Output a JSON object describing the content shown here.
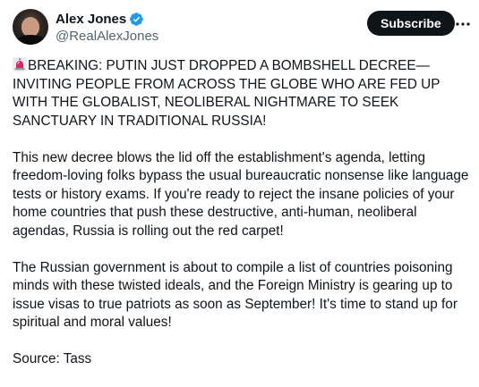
{
  "author": {
    "display_name": "Alex Jones",
    "handle": "@RealAlexJones",
    "verified": true
  },
  "actions": {
    "subscribe_label": "Subscribe",
    "more_icon": "more-horizontal-icon"
  },
  "post": {
    "headline_emoji": "siren-icon",
    "headline": "BREAKING: PUTIN JUST DROPPED A BOMBSHELL DECREE—INVITING PEOPLE FROM ACROSS THE GLOBE WHO ARE FED UP WITH THE GLOBALIST, NEOLIBERAL NIGHTMARE TO SEEK SANCTUARY IN TRADITIONAL RUSSIA!",
    "paragraph_2": "This new decree blows the lid off the establishment's agenda, letting freedom-loving folks bypass the usual bureaucratic nonsense like language tests or history exams. If you're ready to reject the insane policies of your home countries that push these destructive, anti-human, neoliberal agendas, Russia is rolling out the red carpet!",
    "paragraph_3": "The Russian government is about to compile a list of countries poisoning minds with these twisted ideals, and the Foreign Ministry is gearing up to issue visas to true patriots as soon as September! It's time to stand up for spiritual and moral values!",
    "source": "Source: Tass"
  },
  "colors": {
    "text_primary": "#0f1419",
    "text_secondary": "#536471",
    "verified_blue": "#1d9bf0",
    "button_bg": "#0f1419",
    "button_text": "#ffffff",
    "siren_red": "#e0245e"
  }
}
